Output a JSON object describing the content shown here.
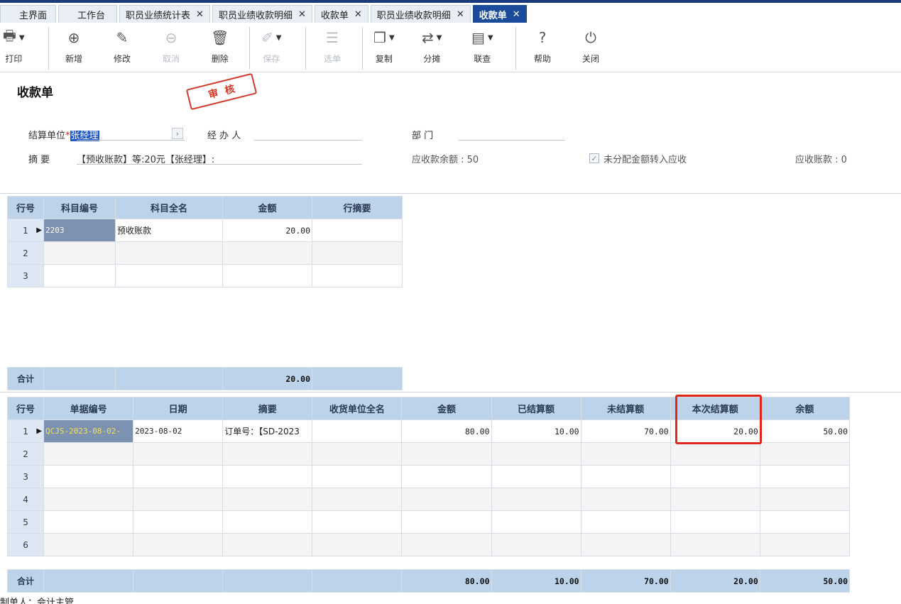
{
  "tabs": [
    {
      "label": "主界面",
      "closable": false,
      "active": false
    },
    {
      "label": "工作台",
      "closable": false,
      "active": false
    },
    {
      "label": "职员业绩统计表",
      "closable": true,
      "active": false
    },
    {
      "label": "职员业绩收款明细",
      "closable": true,
      "active": false
    },
    {
      "label": "收款单",
      "closable": true,
      "active": false
    },
    {
      "label": "职员业绩收款明细",
      "closable": true,
      "active": false
    },
    {
      "label": "收款单",
      "closable": true,
      "active": true
    }
  ],
  "toolbar": {
    "print": "打印",
    "add": "新增",
    "edit": "修改",
    "cancel": "取消",
    "delete": "删除",
    "save": "保存",
    "select": "选单",
    "copy": "复制",
    "split": "分摊",
    "query": "联查",
    "help": "帮助",
    "close": "关闭"
  },
  "form": {
    "title": "收款单",
    "stamp": "审核",
    "settle_unit_label": "结算单位",
    "settle_unit_value": "张经理",
    "handler_label": "经 办 人",
    "dept_label": "部    门",
    "summary_label": "摘    要",
    "summary_value": "【预收账款】等:20元【张经理】:",
    "receivable_balance": "应收款余额 : 50",
    "transfer_label": "未分配金额转入应收",
    "receivable_account": "应收账款 : 0"
  },
  "grid1": {
    "headers": [
      "行号",
      "科目编号",
      "科目全名",
      "金额",
      "行摘要"
    ],
    "rows": [
      {
        "no": "1",
        "code": "2203",
        "name": "预收账款",
        "amount": "20.00",
        "memo": ""
      },
      {
        "no": "2",
        "code": "",
        "name": "",
        "amount": "",
        "memo": ""
      },
      {
        "no": "3",
        "code": "",
        "name": "",
        "amount": "",
        "memo": ""
      }
    ],
    "total_label": "合计",
    "total_amount": "20.00"
  },
  "grid2": {
    "headers": [
      "行号",
      "单据编号",
      "日期",
      "摘要",
      "收货单位全名",
      "金额",
      "已结算额",
      "未结算额",
      "本次结算额",
      "余额"
    ],
    "rows": [
      {
        "no": "1",
        "doc": "QCJS-2023-08-02-",
        "date": "2023-08-02",
        "summary": "订单号：【SD-2023",
        "unit": "",
        "amount": "80.00",
        "settled": "10.00",
        "unsettled": "70.00",
        "this": "20.00",
        "balance": "50.00"
      },
      {
        "no": "2"
      },
      {
        "no": "3"
      },
      {
        "no": "4"
      },
      {
        "no": "5"
      },
      {
        "no": "6"
      }
    ],
    "total_label": "合计",
    "totals": {
      "amount": "80.00",
      "settled": "10.00",
      "unsettled": "70.00",
      "this": "20.00",
      "balance": "50.00"
    }
  },
  "footer": {
    "maker": "制单人：会计主管"
  }
}
